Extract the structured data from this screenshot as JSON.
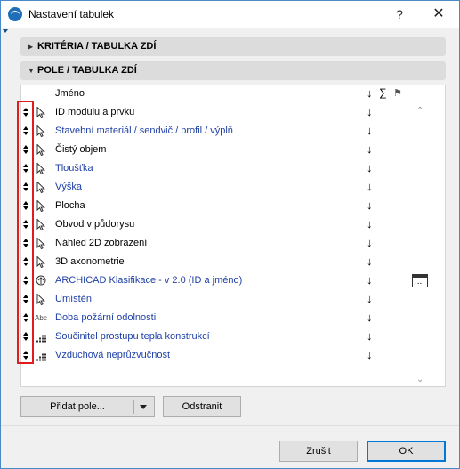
{
  "window": {
    "title": "Nastavení tabulek",
    "help_label": "?",
    "close_label": "✕"
  },
  "sections": [
    {
      "label": "KRITÉRIA /  TABULKA ZDÍ",
      "expanded": false
    },
    {
      "label": "POLE /  TABULKA ZDÍ",
      "expanded": true
    }
  ],
  "table": {
    "header": {
      "name": "Jméno",
      "sort": "↓",
      "sum": "∑",
      "flag": "⚑"
    },
    "rows": [
      {
        "icon": "cursor-icon",
        "name": "ID modulu a prvku",
        "blue": false,
        "sort": "↓"
      },
      {
        "icon": "cursor-icon",
        "name": "Stavební materiál / sendvič / profil / výplň",
        "blue": true,
        "sort": "↓"
      },
      {
        "icon": "cursor-icon",
        "name": "Čistý objem",
        "blue": false,
        "sort": "↓"
      },
      {
        "icon": "cursor-icon",
        "name": "Tloušťka",
        "blue": true,
        "sort": "↓"
      },
      {
        "icon": "cursor-icon",
        "name": "Výška",
        "blue": true,
        "sort": "↓"
      },
      {
        "icon": "cursor-icon",
        "name": "Plocha",
        "blue": false,
        "sort": "↓"
      },
      {
        "icon": "cursor-icon",
        "name": "Obvod v půdorysu",
        "blue": false,
        "sort": "↓"
      },
      {
        "icon": "cursor-icon",
        "name": "Náhled 2D zobrazení",
        "blue": false,
        "sort": "↓"
      },
      {
        "icon": "cursor-icon",
        "name": "3D axonometrie",
        "blue": false,
        "sort": "↓"
      },
      {
        "icon": "classification-icon",
        "name": "ARCHICAD Klasifikace - v 2.0 (ID a jméno)",
        "blue": true,
        "sort": "↓",
        "more": "..."
      },
      {
        "icon": "cursor-icon",
        "name": "Umístění",
        "blue": true,
        "sort": "↓"
      },
      {
        "icon": "text-property-icon",
        "icon_text": "Abc",
        "name": "Doba požární odolnosti",
        "blue": true,
        "sort": "↓"
      },
      {
        "icon": "number-property-icon",
        "name": "Součinitel prostupu tepla konstrukcí",
        "blue": true,
        "sort": "↓"
      },
      {
        "icon": "number-property-icon",
        "name": "Vzduchová neprůzvučnost",
        "blue": true,
        "sort": "↓"
      }
    ]
  },
  "buttons": {
    "add": "Přidat pole...",
    "remove": "Odstranit",
    "cancel": "Zrušit",
    "ok": "OK"
  },
  "colors": {
    "accent": "#0078d7",
    "custom_field_text": "#1e3fa6",
    "highlight_border": "#e01c1c"
  }
}
